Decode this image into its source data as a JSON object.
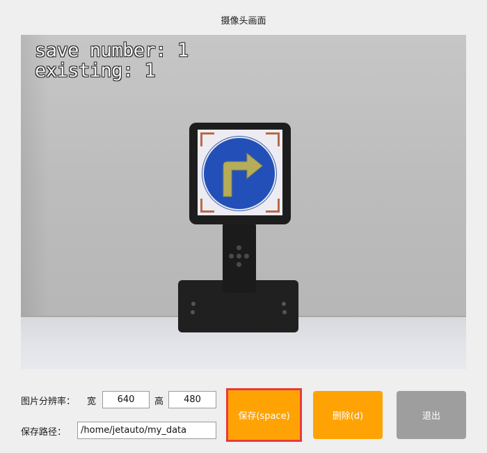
{
  "window": {
    "title": "摄像头画面"
  },
  "camera": {
    "overlay_line1": "save number: 1",
    "overlay_line2": "existing: 1"
  },
  "form": {
    "resolution_label": "图片分辨率：",
    "width_label": "宽",
    "width_value": "640",
    "height_label": "高",
    "height_value": "480",
    "path_label": "保存路径：",
    "path_value": "/home/jetauto/my_data"
  },
  "buttons": {
    "save_label": "保存(space)",
    "delete_label": "删除(d)",
    "exit_label": "退出"
  },
  "colors": {
    "accent": "#ffa304",
    "highlight_border": "#e83a3a",
    "exit_button": "#9e9e9e"
  }
}
